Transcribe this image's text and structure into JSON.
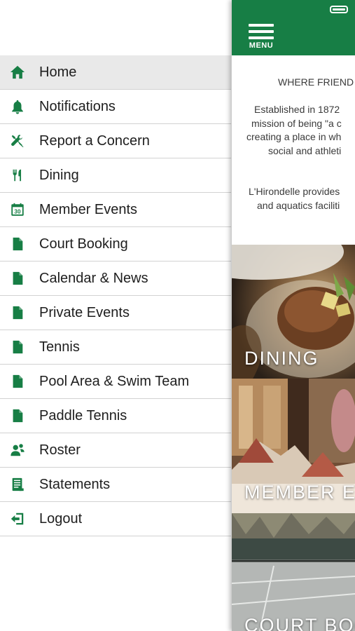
{
  "drawer": {
    "items": [
      {
        "label": "Home",
        "icon": "home-icon"
      },
      {
        "label": "Notifications",
        "icon": "bell-icon"
      },
      {
        "label": "Report a Concern",
        "icon": "tools-icon"
      },
      {
        "label": "Dining",
        "icon": "fork-knife-icon"
      },
      {
        "label": "Member Events",
        "icon": "calendar-icon"
      },
      {
        "label": "Court Booking",
        "icon": "document-icon"
      },
      {
        "label": "Calendar & News",
        "icon": "document-icon"
      },
      {
        "label": "Private Events",
        "icon": "document-icon"
      },
      {
        "label": "Tennis",
        "icon": "document-icon"
      },
      {
        "label": "Pool Area & Swim Team",
        "icon": "document-icon"
      },
      {
        "label": "Paddle Tennis",
        "icon": "document-icon"
      },
      {
        "label": "Roster",
        "icon": "people-icon"
      },
      {
        "label": "Statements",
        "icon": "statement-icon"
      },
      {
        "label": "Logout",
        "icon": "logout-icon"
      }
    ],
    "active_index": 0,
    "calendar_day": "30"
  },
  "main": {
    "menu_label": "MENU",
    "intro_lines": [
      "WHERE FRIEND",
      "Established in 1872",
      "mission of being \"a c",
      "creating a place in wh",
      "social and athleti",
      "L'Hirondelle provides",
      "and aquatics faciliti"
    ],
    "tiles": [
      {
        "caption": "DINING"
      },
      {
        "caption": "MEMBER E"
      },
      {
        "caption": "COURT BOO"
      }
    ]
  },
  "colors": {
    "brand_green": "#177e45",
    "active_row": "#e9e9e9",
    "divider": "#d2d2d2"
  }
}
